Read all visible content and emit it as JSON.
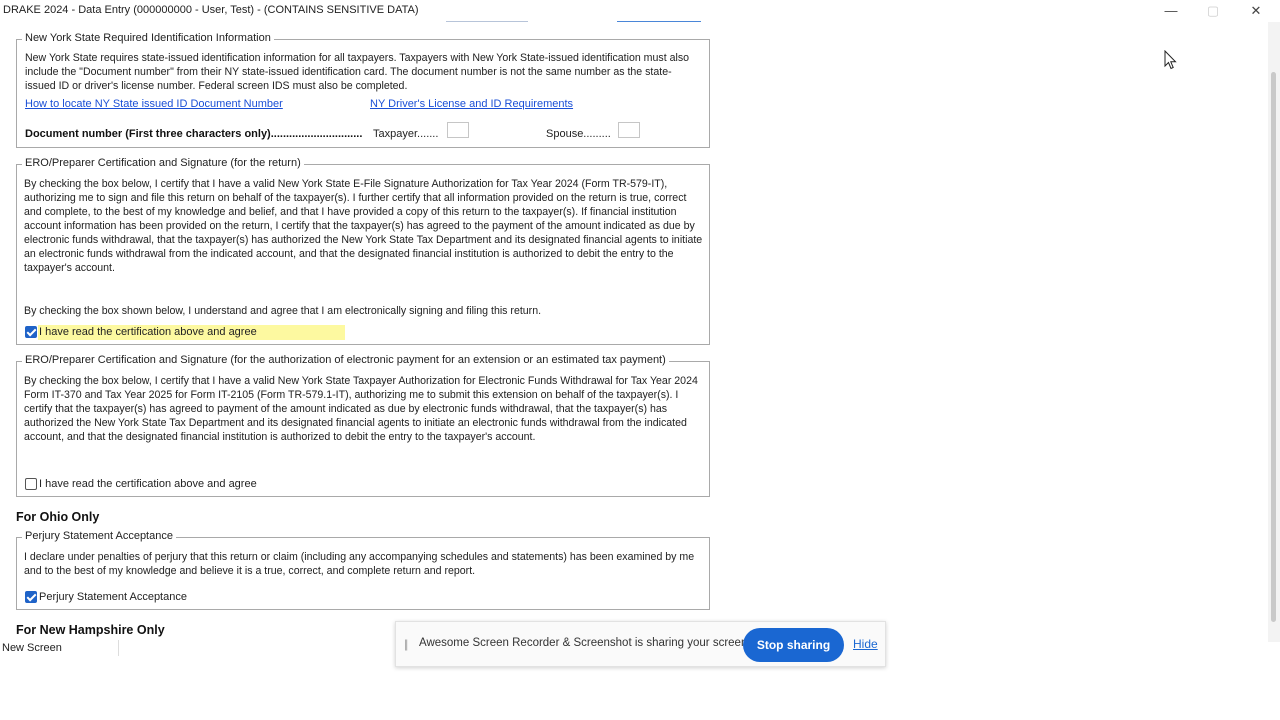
{
  "window": {
    "title": "DRAKE 2024 - Data Entry (000000000 - User, Test) - (CONTAINS SENSITIVE DATA)",
    "minimize": "—",
    "maximize": "▢",
    "close": "✕"
  },
  "ny_id": {
    "legend": "New York State Required Identification Information",
    "text": "New York State requires state-issued identification information for all taxpayers. Taxpayers with New York State-issued identification must also include the \"Document number\" from their NY state-issued identification card. The document number is not the same number as the state-issued ID or driver's license number. Federal screen IDS must also be completed.",
    "link1": "How to locate NY State issued ID Document Number",
    "link2": "NY Driver's License and ID Requirements",
    "doc_label": "Document number (First three characters only)..............................",
    "taxpayer_label": "Taxpayer.......",
    "spouse_label": "Spouse.........",
    "taxpayer_value": "",
    "spouse_value": ""
  },
  "ero_return": {
    "legend": "ERO/Preparer Certification and Signature (for the return)",
    "text": "By checking the box below, I certify that I have a valid New York State E-File Signature Authorization for Tax Year 2024 (Form TR-579-IT), authorizing me to sign and file this return on behalf of the taxpayer(s).  I further certify that all information provided on the return is true, correct and complete, to the best of my knowledge and belief, and that I have provided a copy of this return to the taxpayer(s).  If financial institution account information has been provided on the return, I certify that the taxpayer(s) has agreed to the payment of the amount indicated as due by electronic funds withdrawal, that the taxpayer(s) has authorized the New York State Tax Department and its designated financial agents to initiate an electronic funds withdrawal from the indicated account, and that the designated financial institution is authorized to debit the entry to the taxpayer's account.",
    "text2": "By checking the box shown below, I understand and agree that I am electronically signing and filing this return.",
    "checkbox_label": "I have read the certification above and agree",
    "checked": true
  },
  "ero_payment": {
    "legend": "ERO/Preparer Certification and Signature (for the authorization of electronic payment for an extension or an estimated tax payment)",
    "text": "By checking the box below, I certify that I have a valid New York State Taxpayer Authorization for Electronic Funds Withdrawal for Tax Year 2024 Form IT-370 and Tax Year 2025 for Form IT-2105 (Form TR-579.1-IT), authorizing me to submit this extension on behalf of the taxpayer(s).  I certify that the taxpayer(s) has agreed to payment of the amount indicated as due by electronic funds withdrawal, that the taxpayer(s) has authorized the New York State Tax Department and its designated financial agents to initiate an electronic funds withdrawal from the indicated account, and that the designated financial institution is authorized to debit the entry to the taxpayer's account.",
    "checkbox_label": "I have read the certification above and agree",
    "checked": false
  },
  "ohio": {
    "heading": "For Ohio Only",
    "legend": "Perjury Statement Acceptance",
    "text": "I declare under penalties of perjury that this return or claim (including any accompanying schedules and statements) has been examined by me and to the best of my knowledge and believe it is a true, correct, and complete return and report.",
    "checkbox_label": "Perjury Statement Acceptance",
    "checked": true
  },
  "nh": {
    "heading": "For New Hampshire Only"
  },
  "status_bar": {
    "text": "New Screen"
  },
  "share_bar": {
    "message": "Awesome Screen Recorder & Screenshot is sharing your screen.",
    "stop": "Stop sharing",
    "hide": "Hide"
  }
}
